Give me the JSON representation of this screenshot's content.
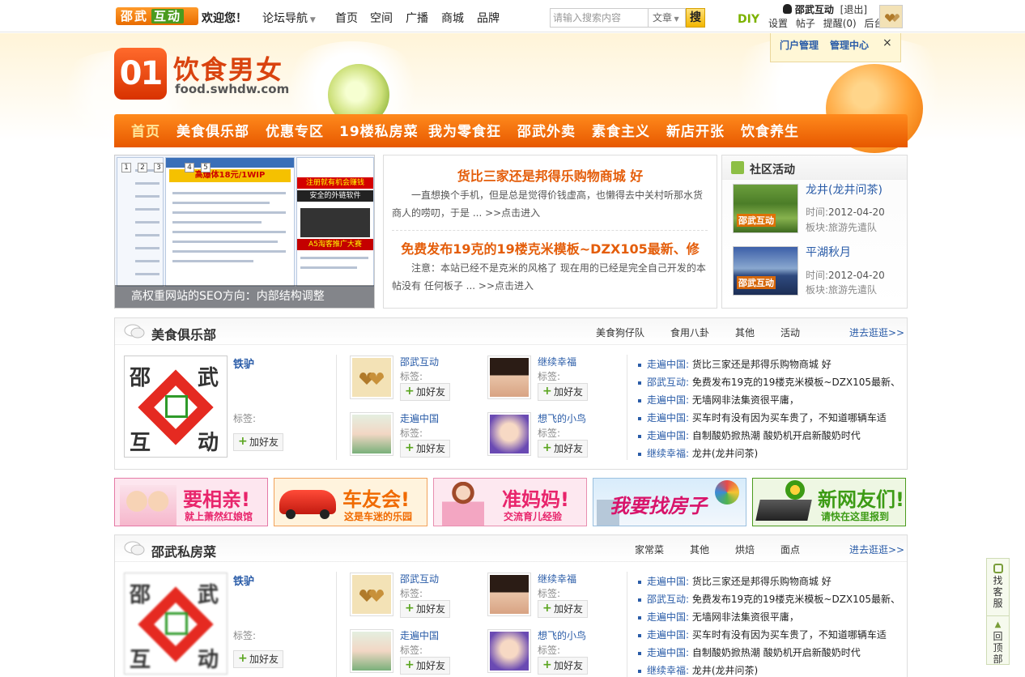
{
  "topbar": {
    "logo_text": "邵武",
    "logo_text2": "互动",
    "welcome": "欢迎您！",
    "forum_nav": "论坛导航",
    "nav": [
      "首页",
      "空间",
      "广播",
      "商城",
      "品牌"
    ],
    "search_placeholder": "请输入搜索内容",
    "search_type": "文章",
    "search_button": "搜",
    "diy": "DIY",
    "username": "邵武互动",
    "logout": "[退出]",
    "user_links": [
      "设置",
      "帖子",
      "提醒(0)",
      "后台"
    ]
  },
  "admin_popup": {
    "portal": "门户管理",
    "center": "管理中心",
    "close": "×"
  },
  "banner": {
    "logo_number": "01",
    "site_name": "饮食男女",
    "site_url": "food.swhdw.com"
  },
  "mainnav": [
    "首页",
    "美食俱乐部",
    "优惠专区",
    "19楼私房菜",
    "我为零食狂",
    "邵武外卖",
    "素食主义",
    "新店开张",
    "饮食养生"
  ],
  "slider": {
    "caption": "高权重网站的SEO方向：内部结构调整",
    "dots": [
      "1",
      "2",
      "3",
      "4",
      "5"
    ],
    "ad_1": "高爆体18元/1WIP",
    "ad_2": "注册就有机会赚钱",
    "ad_3": "安全的外链软件",
    "ad_4": "A5淘客推广大赛"
  },
  "news": [
    {
      "title": "货比三家还是邦得乐购物商城 好",
      "text": "一直想换个手机，但是总是觉得价钱虚高，也懒得去中关村听那水货商人的唠叨，于是 ... >>点击进入"
    },
    {
      "title": "免费发布19克的19楼克米模板~DZX105最新、修",
      "text": "注意：本站已经不是克米的风格了 现在用的已经是完全自己开发的本帖没有 任何板子 ... >>点击进入"
    }
  ],
  "activity": {
    "title": "社区活动",
    "items": [
      {
        "title": "龙井(龙井问茶)",
        "time_label": "时间:",
        "time": "2012-04-20",
        "board_label": "板块:",
        "board": "旅游先遣队",
        "img_text": "邵武互动"
      },
      {
        "title": "平湖秋月",
        "time_label": "时间:",
        "time": "2012-04-20",
        "board_label": "板块:",
        "board": "旅游先遣队",
        "img_text": "邵武互动"
      }
    ]
  },
  "sections": [
    {
      "title": "美食俱乐部",
      "tabs": [
        "美食狗仔队",
        "食用八卦",
        "其他",
        "活动"
      ],
      "more": "进去逛逛>>",
      "featured": {
        "name": "铁驴",
        "tag_label": "标签:",
        "add": "加好友",
        "img_text": [
          "邵",
          "武",
          "互",
          "动"
        ]
      },
      "users": [
        {
          "name": "邵武互动",
          "tag_label": "标签:",
          "add": "加好友"
        },
        {
          "name": "继续幸福",
          "tag_label": "标签:",
          "add": "加好友"
        },
        {
          "name": "走遍中国",
          "tag_label": "标签:",
          "add": "加好友"
        },
        {
          "name": "想飞的小鸟",
          "tag_label": "标签:",
          "add": "加好友"
        }
      ],
      "list": [
        {
          "author": "走遍中国:",
          "title": "货比三家还是邦得乐购物商城 好"
        },
        {
          "author": "邵武互动:",
          "title": "免费发布19克的19楼克米模板~DZX105最新、"
        },
        {
          "author": "走遍中国:",
          "title": "无墙网非法集资很平庸，"
        },
        {
          "author": "走遍中国:",
          "title": "买车时有没有因为买车贵了，不知道哪辆车适"
        },
        {
          "author": "走遍中国:",
          "title": "自制酸奶掀热潮 酸奶机开启新酸奶时代"
        },
        {
          "author": "继续幸福:",
          "title": "龙井(龙井问茶)"
        }
      ]
    },
    {
      "title": "邵武私房菜",
      "tabs": [
        "家常菜",
        "其他",
        "烘焙",
        "面点"
      ],
      "more": "进去逛逛>>",
      "featured": {
        "name": "铁驴",
        "tag_label": "标签:",
        "add": "加好友",
        "img_text": [
          "邵",
          "武",
          "互",
          "动"
        ]
      },
      "users": [
        {
          "name": "邵武互动",
          "tag_label": "标签:",
          "add": "加好友"
        },
        {
          "name": "继续幸福",
          "tag_label": "标签:",
          "add": "加好友"
        },
        {
          "name": "走遍中国",
          "tag_label": "标签:",
          "add": "加好友"
        },
        {
          "name": "想飞的小鸟",
          "tag_label": "标签:",
          "add": "加好友"
        }
      ],
      "list": [
        {
          "author": "走遍中国:",
          "title": "货比三家还是邦得乐购物商城 好"
        },
        {
          "author": "邵武互动:",
          "title": "免费发布19克的19楼克米模板~DZX105最新、"
        },
        {
          "author": "走遍中国:",
          "title": "无墙网非法集资很平庸，"
        },
        {
          "author": "走遍中国:",
          "title": "买车时有没有因为买车贵了，不知道哪辆车适"
        },
        {
          "author": "走遍中国:",
          "title": "自制酸奶掀热潮 酸奶机开启新酸奶时代"
        },
        {
          "author": "继续幸福:",
          "title": "龙井(龙井问茶)"
        }
      ]
    }
  ],
  "promos": [
    {
      "t1": "要相亲!",
      "t2": "就上萧然红娘馆",
      "color": "#e8246b",
      "bg": "#fde6ef"
    },
    {
      "t1": "车友会!",
      "t2": "这是车迷的乐园",
      "color": "#f06a00",
      "bg": "#fff3dd"
    },
    {
      "t1": "准妈妈!",
      "t2": "交流育儿经验",
      "color": "#e8246b",
      "bg": "#fde8f0"
    },
    {
      "t1": "我要找房子",
      "t2": "",
      "color": "#d8146a",
      "bg": "#e7f1fb"
    },
    {
      "t1": "新网友们!",
      "t2": "请快在这里报到",
      "color": "#3c9b14",
      "bg": "#eef7e3"
    }
  ],
  "side_tool": {
    "service": "找客服",
    "top": "回顶部"
  }
}
